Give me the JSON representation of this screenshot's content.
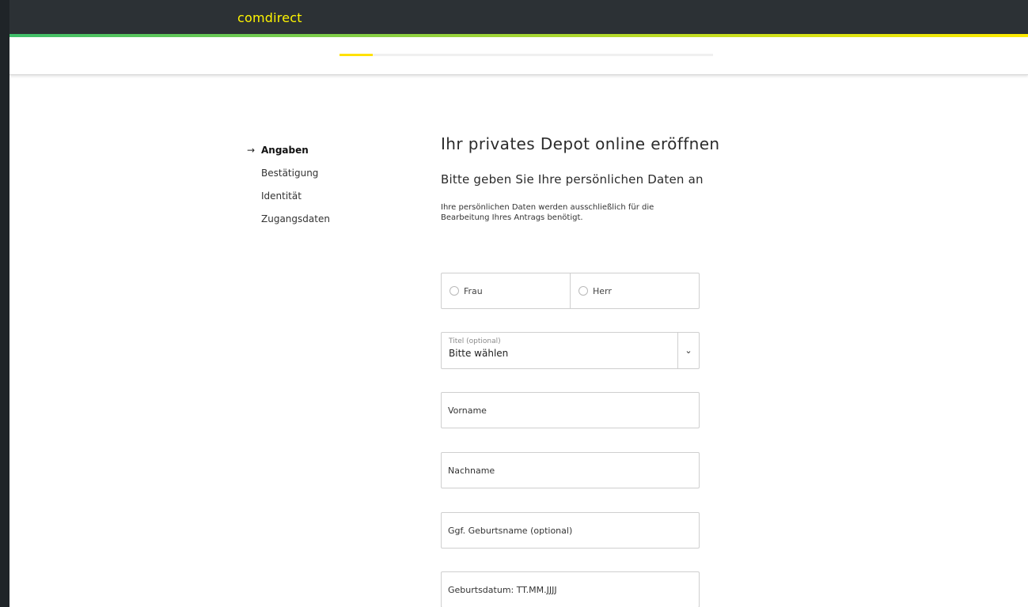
{
  "header": {
    "logo": "comdirect"
  },
  "progress": {
    "fraction": 0.09
  },
  "steps": [
    {
      "label": "Angaben",
      "active": true
    },
    {
      "label": "Bestätigung",
      "active": false
    },
    {
      "label": "Identität",
      "active": false
    },
    {
      "label": "Zugangsdaten",
      "active": false
    }
  ],
  "content": {
    "title": "Ihr privates Depot online eröffnen",
    "subtitle": "Bitte geben Sie Ihre persönlichen Daten an",
    "lead": "Ihre persönlichen Daten werden ausschließlich für die Bearbeitung Ihres Antrags benötigt."
  },
  "salutation": {
    "options": [
      "Frau",
      "Herr"
    ]
  },
  "title_select": {
    "caption": "Titel (optional)",
    "value": "Bitte wählen"
  },
  "fields": {
    "first_name": "Vorname",
    "last_name": "Nachname",
    "birth_name": "Ggf. Geburtsname (optional)",
    "birth_date": "Geburtsdatum: TT.MM.JJJJ"
  }
}
